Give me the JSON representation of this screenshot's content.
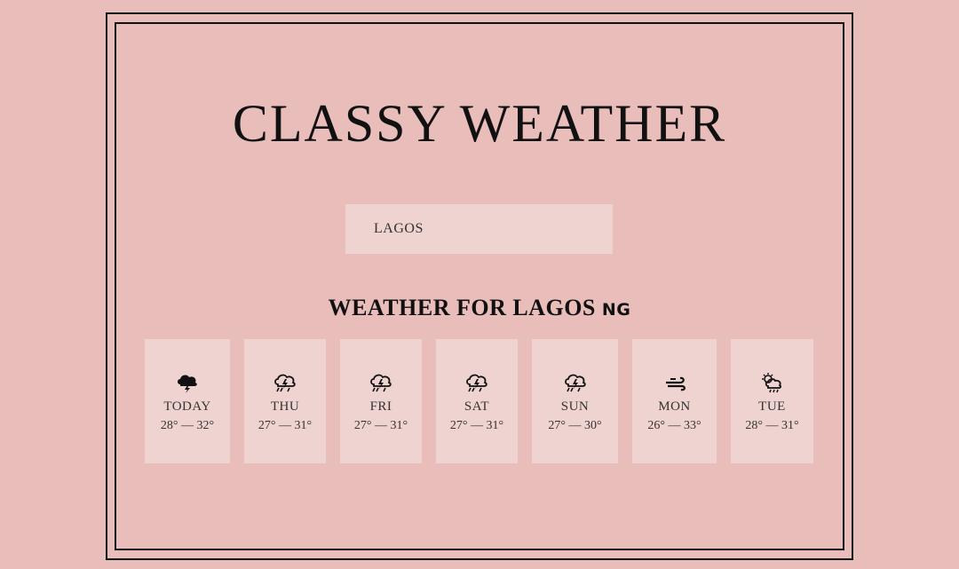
{
  "app": {
    "title": "Classy Weather"
  },
  "search": {
    "value": "LAGOS"
  },
  "forecast": {
    "heading_prefix": "Weather for ",
    "city": "Lagos",
    "country_code": "NG",
    "days": [
      {
        "day": "TODAY",
        "temp": "28° — 32°",
        "icon": "thunderstorm-icon"
      },
      {
        "day": "THU",
        "temp": "27° — 31°",
        "icon": "thunderstorm-rain-icon"
      },
      {
        "day": "FRI",
        "temp": "27° — 31°",
        "icon": "thunderstorm-rain-icon"
      },
      {
        "day": "SAT",
        "temp": "27° — 31°",
        "icon": "thunderstorm-rain-icon"
      },
      {
        "day": "SUN",
        "temp": "27° — 30°",
        "icon": "thunderstorm-rain-icon"
      },
      {
        "day": "MON",
        "temp": "26° — 33°",
        "icon": "wind-icon"
      },
      {
        "day": "TUE",
        "temp": "28° — 31°",
        "icon": "sun-cloud-rain-icon"
      }
    ]
  },
  "colors": {
    "background": "#e9bdb9",
    "card": "#eed3d0",
    "ink": "#111111"
  }
}
